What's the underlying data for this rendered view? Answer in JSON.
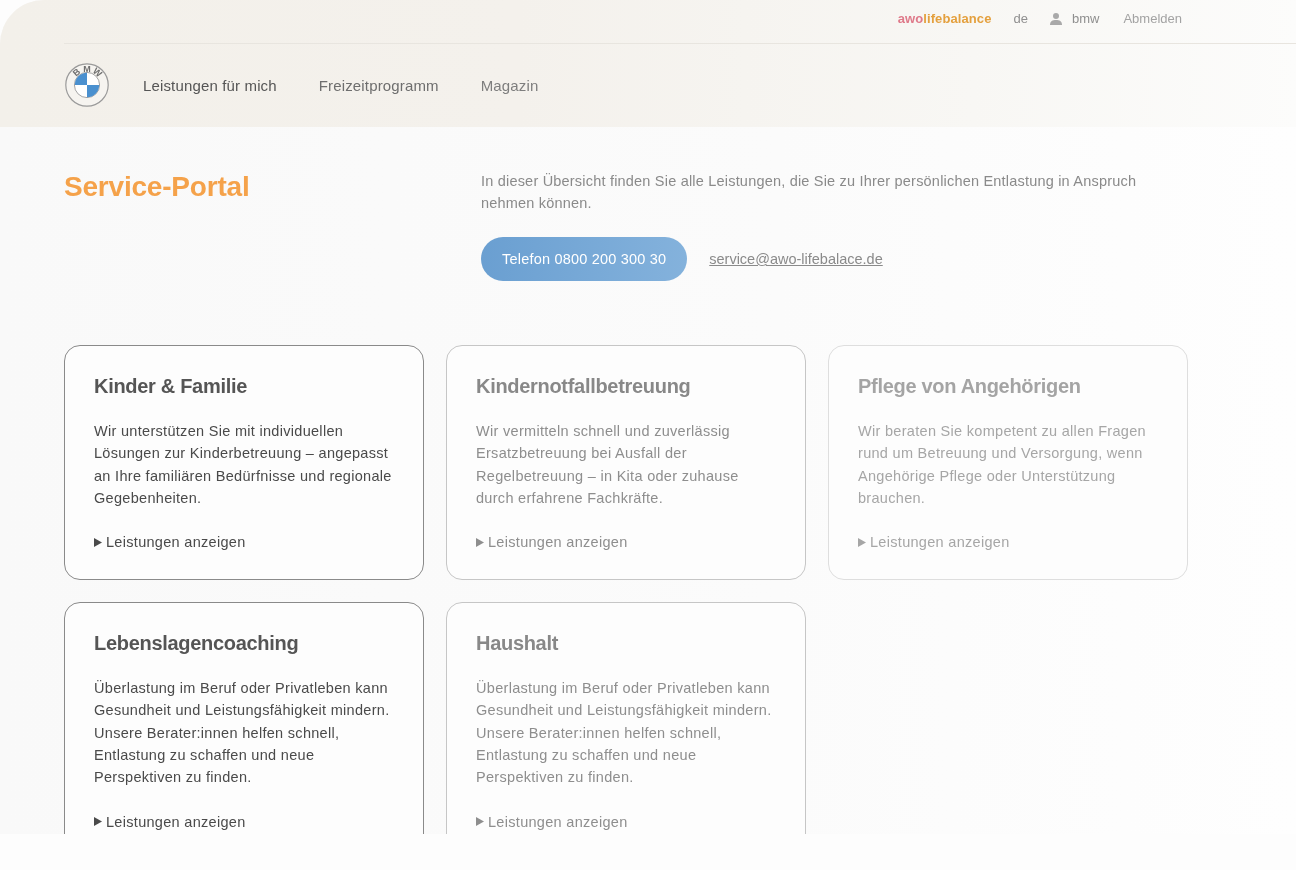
{
  "top_bar": {
    "brand": {
      "prefix": "awo",
      "suffix": "lifebalance"
    },
    "language": "de",
    "user": "bmw",
    "logout": "Abmelden"
  },
  "nav": {
    "logo_letters": [
      "B",
      "M",
      "W"
    ],
    "items": [
      "Leistungen für mich",
      "Freizeitprogramm",
      "Magazin"
    ]
  },
  "intro": {
    "title": "Service-Portal",
    "text": "In dieser Übersicht finden Sie alle Leistungen, die Sie zu Ihrer persönlichen Entlastung in Anspruch nehmen können.",
    "phone_button": "Telefon 0800 200 300 30",
    "email_link": "service@awo-lifebalace.de"
  },
  "cards": [
    {
      "title": "Kinder & Familie",
      "text": "Wir unterstützen Sie mit individuellen Lösungen zur Kinderbetreuung – angepasst an Ihre familiären Bedürfnisse und regionale Gegebenheiten.",
      "link": "Leistungen anzeigen"
    },
    {
      "title": "Kindernotfallbetreuung",
      "text": "Wir vermitteln schnell und zuverlässig Ersatzbetreuung bei Ausfall der Regelbetreuung – in Kita oder zuhause durch erfahrene Fachkräfte.",
      "link": "Leistungen anzeigen"
    },
    {
      "title": "Pflege von Angehörigen",
      "text": "Wir beraten Sie kompetent zu allen Fragen rund um Betreuung und Versorgung, wenn Angehörige Pflege oder Unterstützung brauchen.",
      "link": "Leistungen anzeigen"
    },
    {
      "title": "Lebenslagencoaching",
      "text": "Überlastung im Beruf oder Privatleben kann Gesundheit und Leistungsfähigkeit mindern. Unsere Berater:innen helfen schnell, Entlastung zu schaffen und neue Perspektiven zu finden.",
      "link": "Leistungen anzeigen"
    },
    {
      "title": "Haushalt",
      "text": "Überlastung im Beruf oder Privatleben kann Gesundheit und Leistungsfähigkeit mindern. Unsere Berater:innen helfen schnell, Entlastung zu schaffen und neue Perspektiven zu finden.",
      "link": "Leistungen anzeigen"
    }
  ]
}
